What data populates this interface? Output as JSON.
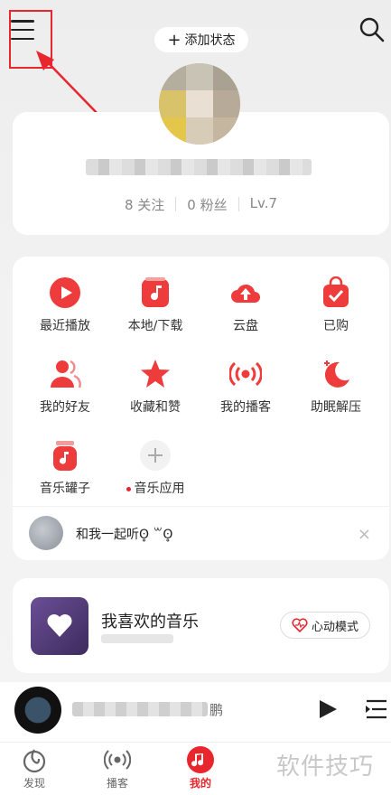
{
  "top": {
    "status_label": "添加状态",
    "status_plus": "+"
  },
  "profile": {
    "stats": [
      {
        "count": "8",
        "label": "关注"
      },
      {
        "count": "0",
        "label": "粉丝"
      },
      {
        "level": "Lv.7"
      }
    ]
  },
  "grid": [
    {
      "label": "最近播放",
      "icon": "play-circle-icon"
    },
    {
      "label": "本地/下载",
      "icon": "music-note-icon"
    },
    {
      "label": "云盘",
      "icon": "cloud-upload-icon"
    },
    {
      "label": "已购",
      "icon": "shopping-bag-icon"
    },
    {
      "label": "我的好友",
      "icon": "friends-icon"
    },
    {
      "label": "收藏和赞",
      "icon": "star-icon"
    },
    {
      "label": "我的播客",
      "icon": "podcast-icon"
    },
    {
      "label": "助眠解压",
      "icon": "moon-icon"
    },
    {
      "label": "音乐罐子",
      "icon": "music-jar-icon"
    },
    {
      "label": "音乐应用",
      "icon": "add-icon"
    }
  ],
  "listen": {
    "text": "和我一起听ʘ̥ ꒳ʘ̥",
    "close": "×"
  },
  "favorites": {
    "title": "我喜欢的音乐",
    "heart_mode": "心动模式"
  },
  "player": {
    "artist": "鹏",
    "play": "▶"
  },
  "tabs": [
    {
      "label": "发现",
      "active": false
    },
    {
      "label": "播客",
      "active": false
    },
    {
      "label": "我的",
      "active": true
    }
  ],
  "watermark": "软件技巧",
  "colors": {
    "accent": "#e8262e",
    "bg": "#f2f2f2",
    "card": "#ffffff"
  }
}
